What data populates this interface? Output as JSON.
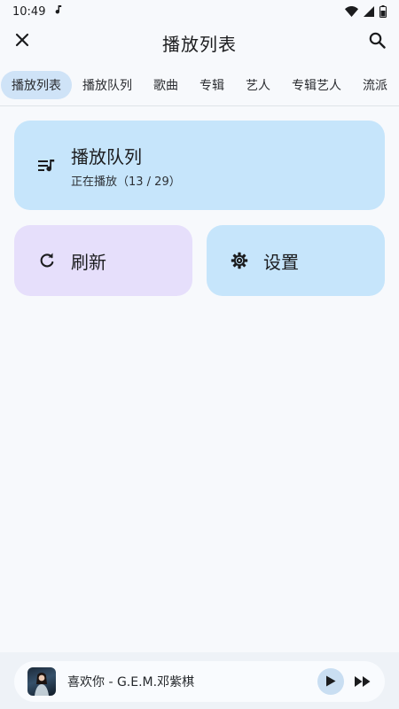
{
  "status_bar": {
    "time": "10:49"
  },
  "app_bar": {
    "title": "播放列表"
  },
  "tabs": [
    {
      "label": "播放列表",
      "active": true
    },
    {
      "label": "播放队列"
    },
    {
      "label": "歌曲"
    },
    {
      "label": "专辑"
    },
    {
      "label": "艺人"
    },
    {
      "label": "专辑艺人"
    },
    {
      "label": "流派"
    }
  ],
  "cards": {
    "queue": {
      "title": "播放队列",
      "subtitle": "正在播放（13 / 29）"
    },
    "refresh": {
      "label": "刷新"
    },
    "settings": {
      "label": "设置"
    }
  },
  "player": {
    "now_playing": "喜欢你 - G.E.M.邓紫棋"
  },
  "colors": {
    "primary_card": "#c6e5fb",
    "secondary_card": "#e6dffb",
    "active_tab": "#cfe3f7",
    "play_button": "#c9def2"
  }
}
